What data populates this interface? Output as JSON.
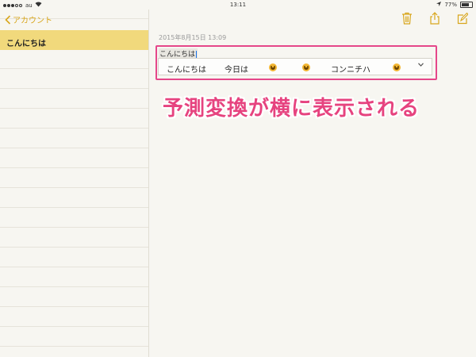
{
  "status": {
    "carrier": "au",
    "time": "13:11",
    "battery": "77%"
  },
  "sidebar": {
    "back_label": "アカウント",
    "items": [
      {
        "title": "こんにちは"
      }
    ]
  },
  "note": {
    "datetime": "2015年8月15日 13:09",
    "text": "こんにちは"
  },
  "candidates": [
    {
      "label": "こんにちは"
    },
    {
      "label": "今日は"
    },
    {
      "icon": "grinning-emoji-icon"
    },
    {
      "icon": "grinning-emoji-icon"
    },
    {
      "label": "コンニチハ"
    },
    {
      "icon": "grinning-emoji-icon"
    }
  ],
  "candidates_expand_icon": "chevron-down-icon",
  "caption": "予測変換が横に表示される",
  "colors": {
    "accent": "#d8a61c",
    "selected_row": "#f1d97c",
    "highlight": "#e5478a",
    "caption": "#e6437f"
  },
  "toolbar_icons": [
    "trash-icon",
    "share-icon",
    "compose-icon"
  ]
}
